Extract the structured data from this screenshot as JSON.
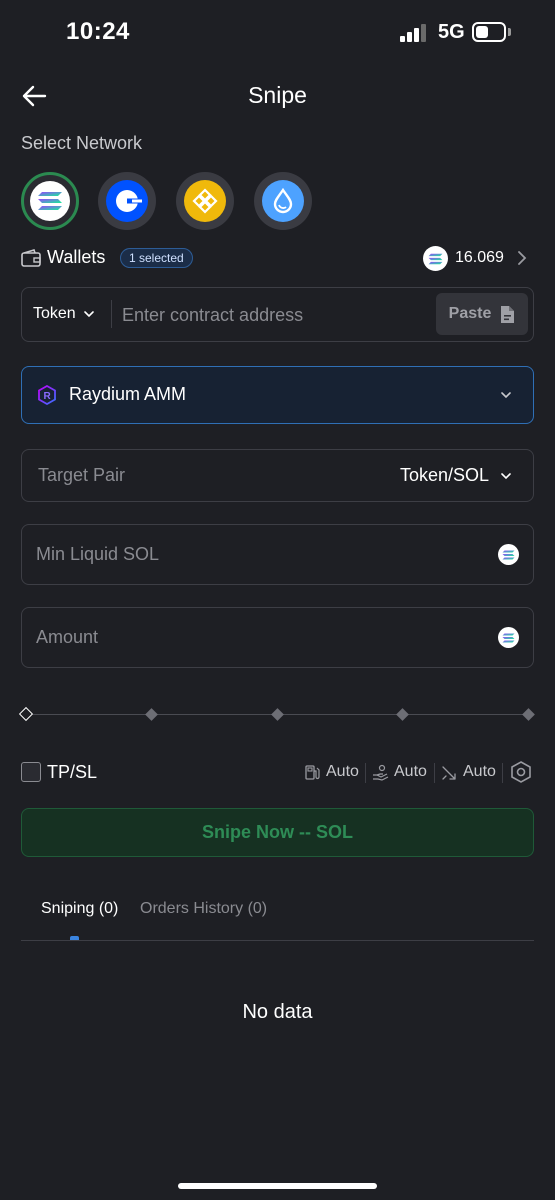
{
  "status_bar": {
    "time": "10:24",
    "network": "5G",
    "battery_level": 0.45
  },
  "header": {
    "title": "Snipe",
    "back_icon": "arrow-left-icon"
  },
  "network_section": {
    "label": "Select Network",
    "networks": [
      {
        "icon": "solana-icon",
        "selected": true
      },
      {
        "icon": "base-icon",
        "selected": false
      },
      {
        "icon": "bnb-icon",
        "selected": false
      },
      {
        "icon": "sui-icon",
        "selected": false
      }
    ]
  },
  "wallets": {
    "label": "Wallets",
    "badge": "1 selected",
    "balance": "16.069"
  },
  "token_input": {
    "selector": "Token",
    "placeholder": "Enter contract address",
    "value": "",
    "paste_label": "Paste"
  },
  "dex": {
    "label": "Raydium AMM"
  },
  "target_pair": {
    "label": "Target Pair",
    "value": "Token/SOL"
  },
  "min_liquid": {
    "placeholder": "Min Liquid SOL"
  },
  "amount": {
    "placeholder": "Amount"
  },
  "slider": {
    "value": 0
  },
  "tpsl": {
    "label": "TP/SL",
    "checked": false,
    "gas_label": "Auto",
    "tip_label": "Auto",
    "slippage_label": "Auto"
  },
  "snipe_button": {
    "label": "Snipe Now -- SOL"
  },
  "tabs": [
    {
      "label": "Sniping (0)",
      "active": true
    },
    {
      "label": "Orders History (0)",
      "active": false
    }
  ],
  "empty_state": {
    "text": "No data"
  },
  "colors": {
    "background": "#1e1f24",
    "accent_green": "#2e8c56",
    "accent_blue": "#3a84e0"
  }
}
